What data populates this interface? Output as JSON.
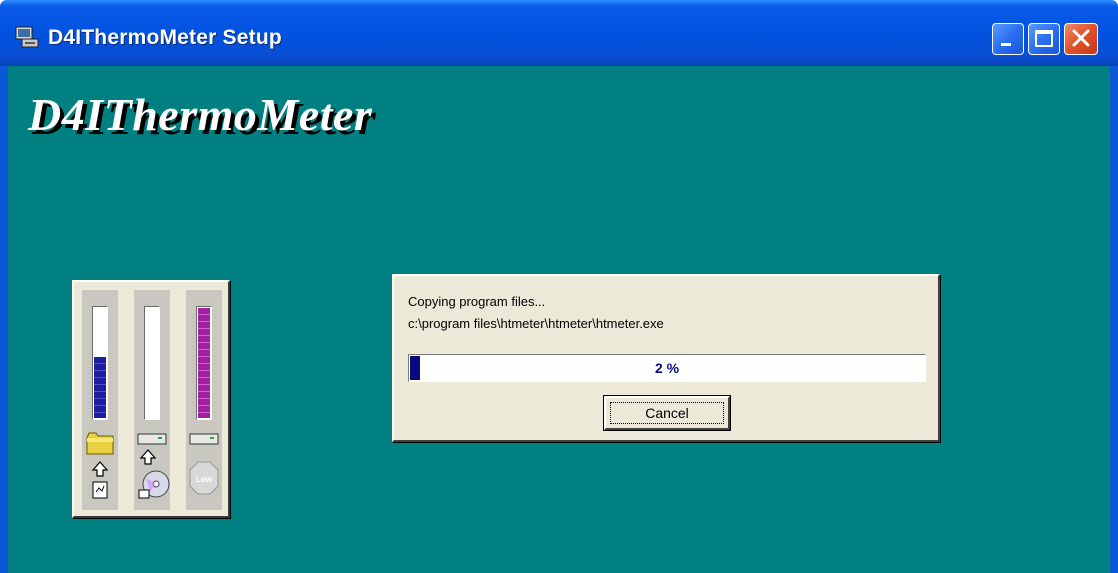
{
  "window": {
    "title": "D4IThermoMeter Setup",
    "app_icon": "setup-computer-icon",
    "controls": [
      "minimize-icon",
      "maximize-icon",
      "close-icon"
    ]
  },
  "banner": {
    "text": "D4IThermoMeter"
  },
  "meters": [
    {
      "name": "disk-space",
      "level_percent": 55,
      "color": "#1e1e9e",
      "icon": "folder-arrow-file-icon"
    },
    {
      "name": "source",
      "level_percent": 0,
      "color": "#1e1e9e",
      "icon": "drive-arrow-cd-icon"
    },
    {
      "name": "memory",
      "level_percent": 100,
      "color": "#a020a0",
      "icon": "drive-low-icon",
      "low_label": "Low"
    }
  ],
  "dialog": {
    "status_text": "Copying program files...",
    "file_path": "c:\\program files\\htmeter\\htmeter\\htmeter.exe",
    "progress_percent": 2,
    "progress_label": "2 %",
    "cancel_label": "Cancel"
  },
  "colors": {
    "background": "#008080",
    "titlebar": "#0a5ae6",
    "progress": "#0a0a80"
  }
}
